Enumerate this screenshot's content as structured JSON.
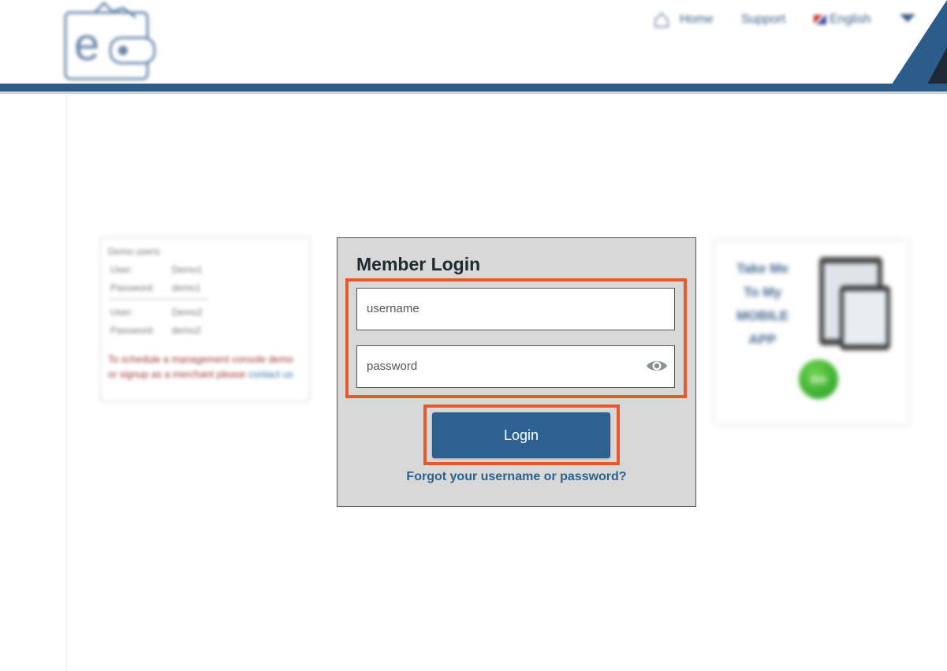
{
  "header": {
    "nav": {
      "home_label": "Home",
      "support_label": "Support",
      "language_label": "English"
    },
    "brand_color": "#2c5d8a"
  },
  "demo_users": {
    "title": "Demo users:",
    "users": [
      {
        "user_key": "User:",
        "user_value": "Demo1",
        "pass_key": "Password:",
        "pass_value": "demo1"
      },
      {
        "user_key": "User:",
        "user_value": "Demo2",
        "pass_key": "Password:",
        "pass_value": "demo2"
      }
    ],
    "note_text": "To schedule a management console demo or signup as a merchant please",
    "note_link": "contact us"
  },
  "login": {
    "title": "Member Login",
    "username_placeholder": "username",
    "password_placeholder": "password",
    "login_button": "Login",
    "forgot_link": "Forgot your username or password?",
    "highlight_color": "#e45a2c",
    "button_color": "#2c6190"
  },
  "mobile_app": {
    "text_lines": [
      "Take Me",
      "To My",
      "MOBILE",
      "APP"
    ],
    "go_label": "GO"
  }
}
